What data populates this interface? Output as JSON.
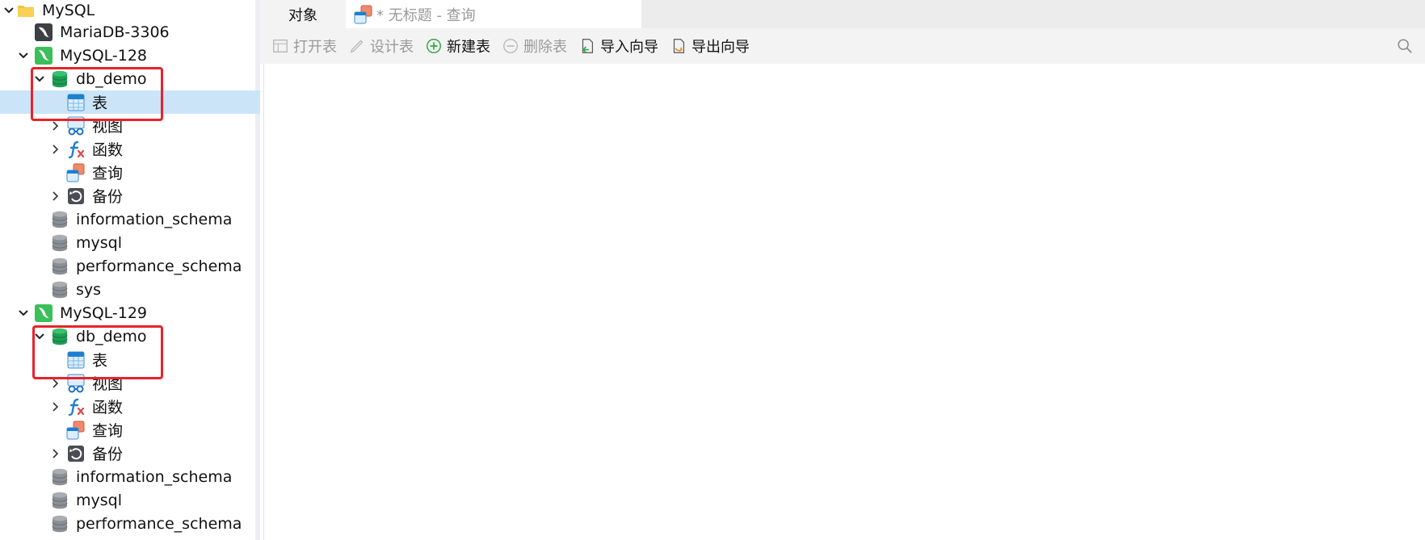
{
  "tabs": [
    {
      "label": "对象",
      "active": true
    },
    {
      "label": "* 无标题 - 查询",
      "active": false,
      "icon": "query-icon"
    }
  ],
  "toolbar": {
    "buttons": [
      {
        "label": "打开表",
        "icon": "open-table-icon",
        "enabled": false
      },
      {
        "label": "设计表",
        "icon": "design-table-icon",
        "enabled": false
      },
      {
        "label": "新建表",
        "icon": "new-table-icon",
        "enabled": true
      },
      {
        "label": "删除表",
        "icon": "delete-table-icon",
        "enabled": false
      },
      {
        "label": "导入向导",
        "icon": "import-wizard-icon",
        "enabled": true
      },
      {
        "label": "导出向导",
        "icon": "export-wizard-icon",
        "enabled": true
      }
    ],
    "search_icon": "search-icon"
  },
  "tree": {
    "group": {
      "label": "MySQL"
    },
    "connections": [
      {
        "label": "MariaDB-3306",
        "icon": "mariadb-connection-icon"
      },
      {
        "label": "MySQL-128",
        "icon": "mysql-connection-icon",
        "databases": [
          {
            "label": "db_demo",
            "open": true,
            "children": [
              {
                "label": "表",
                "icon": "table-icon",
                "selected": true
              },
              {
                "label": "视图",
                "icon": "view-icon"
              },
              {
                "label": "函数",
                "icon": "function-icon"
              },
              {
                "label": "查询",
                "icon": "query-icon"
              },
              {
                "label": "备份",
                "icon": "backup-icon"
              }
            ]
          },
          {
            "label": "information_schema"
          },
          {
            "label": "mysql"
          },
          {
            "label": "performance_schema"
          },
          {
            "label": "sys"
          }
        ]
      },
      {
        "label": "MySQL-129",
        "icon": "mysql-connection-icon",
        "databases": [
          {
            "label": "db_demo",
            "open": true,
            "children": [
              {
                "label": "表",
                "icon": "table-icon"
              },
              {
                "label": "视图",
                "icon": "view-icon"
              },
              {
                "label": "函数",
                "icon": "function-icon"
              },
              {
                "label": "查询",
                "icon": "query-icon"
              },
              {
                "label": "备份",
                "icon": "backup-icon"
              }
            ]
          },
          {
            "label": "information_schema"
          },
          {
            "label": "mysql"
          },
          {
            "label": "performance_schema"
          }
        ]
      }
    ]
  },
  "colors": {
    "highlight": "#e8222b",
    "selection": "#cce4f7",
    "db_open": "#1f9d55",
    "db_closed": "#8a8f95",
    "mysql_green": "#3bbf5a"
  }
}
